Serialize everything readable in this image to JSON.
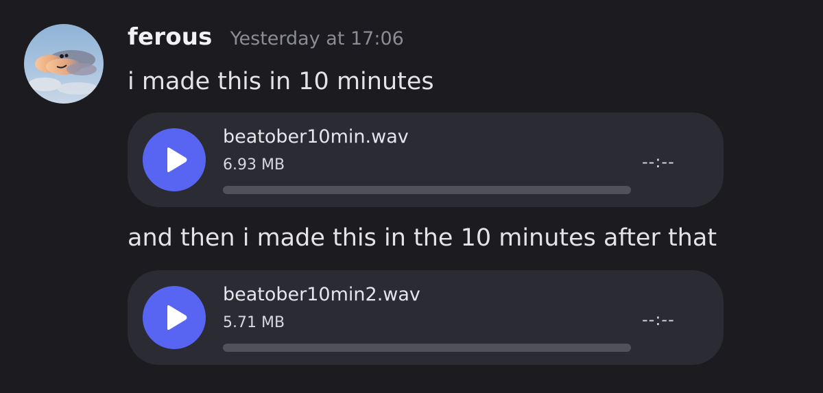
{
  "author": {
    "username": "ferous",
    "timestamp": "Yesterday at 17:06",
    "avatar_icon": "cloud-face-avatar"
  },
  "messages": [
    {
      "text": "i made this in 10 minutes",
      "attachment": {
        "file_name": "beatober10min.wav",
        "file_size": "6.93 MB",
        "duration": "--:--",
        "progress": 0
      }
    },
    {
      "text": "and then i made this in the 10 minutes after that",
      "attachment": {
        "file_name": "beatober10min2.wav",
        "file_size": "5.71 MB",
        "duration": "--:--",
        "progress": 0
      }
    }
  ],
  "colors": {
    "background": "#1b1b20",
    "attachment_bg": "#2b2c33",
    "accent": "#5865f2",
    "timestamp": "#8b8c94",
    "progress_track": "#50515a"
  },
  "icons": {
    "play": "play-icon"
  }
}
